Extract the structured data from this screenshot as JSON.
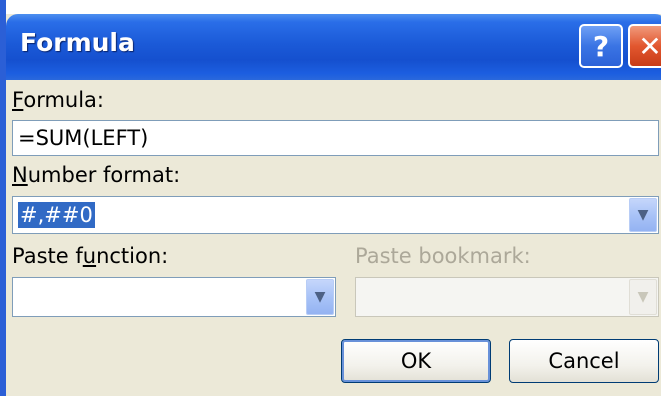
{
  "dialog": {
    "title": "Formula",
    "help_icon": "question-mark",
    "close_icon": "close-x"
  },
  "formula": {
    "label_prefix": "",
    "label_mnemonic": "F",
    "label_rest": "ormula:",
    "value": "=SUM(LEFT)"
  },
  "number_format": {
    "label_mnemonic": "N",
    "label_rest": "umber format:",
    "value": "#,##0"
  },
  "paste_function": {
    "label_prefix": "Paste f",
    "label_mnemonic": "u",
    "label_rest": "nction:",
    "value": ""
  },
  "paste_bookmark": {
    "label": "Paste bookmark:",
    "value": "",
    "enabled": false
  },
  "buttons": {
    "ok": "OK",
    "cancel": "Cancel"
  },
  "colors": {
    "title_bar": "#1550cf",
    "dialog_bg": "#ece9d8",
    "selection": "#316ac5"
  }
}
